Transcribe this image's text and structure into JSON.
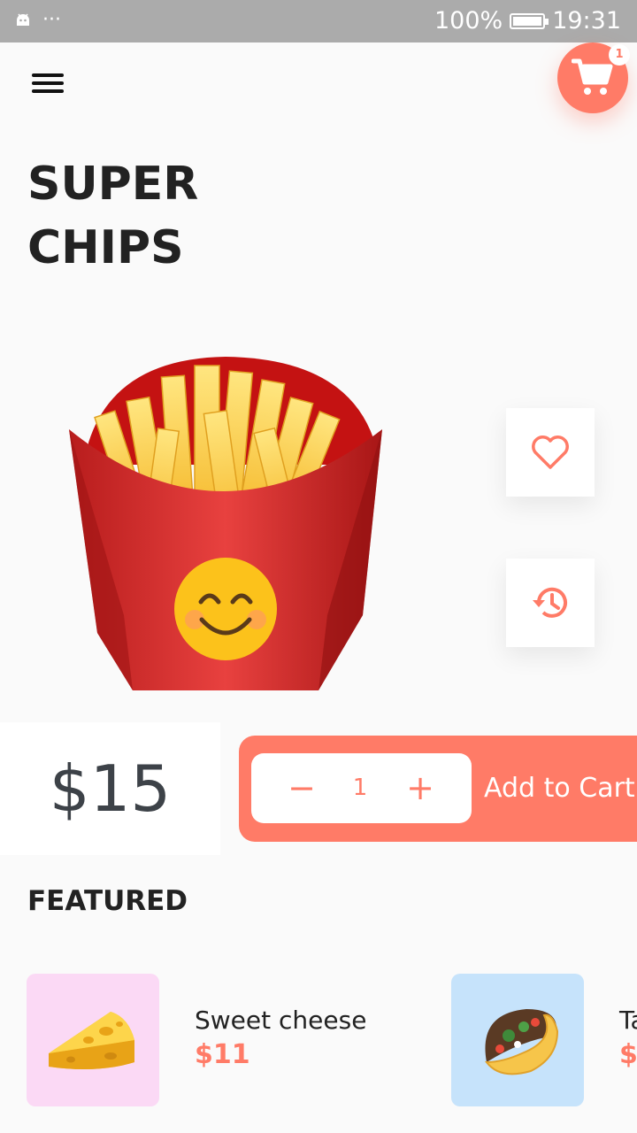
{
  "status_bar": {
    "battery": "100%",
    "time": "19:31",
    "dots": "···"
  },
  "header": {
    "cart_count": "1"
  },
  "product": {
    "title_line1": "SUPER",
    "title_line2": "CHIPS",
    "price": "$15"
  },
  "actions": {
    "favorite_icon": "heart-icon",
    "history_icon": "history-icon"
  },
  "cart_bar": {
    "minus": "−",
    "quantity": "1",
    "plus": "+",
    "add_label": "Add to Cart"
  },
  "featured": {
    "heading": "FEATURED",
    "items": [
      {
        "name": "Sweet cheese",
        "price": "$11",
        "bg": "#fbd9f5"
      },
      {
        "name": "Ta",
        "price": "$",
        "bg": "#c6e3fb"
      }
    ]
  },
  "colors": {
    "accent": "#ff7b67",
    "status_bar": "#ababab"
  }
}
